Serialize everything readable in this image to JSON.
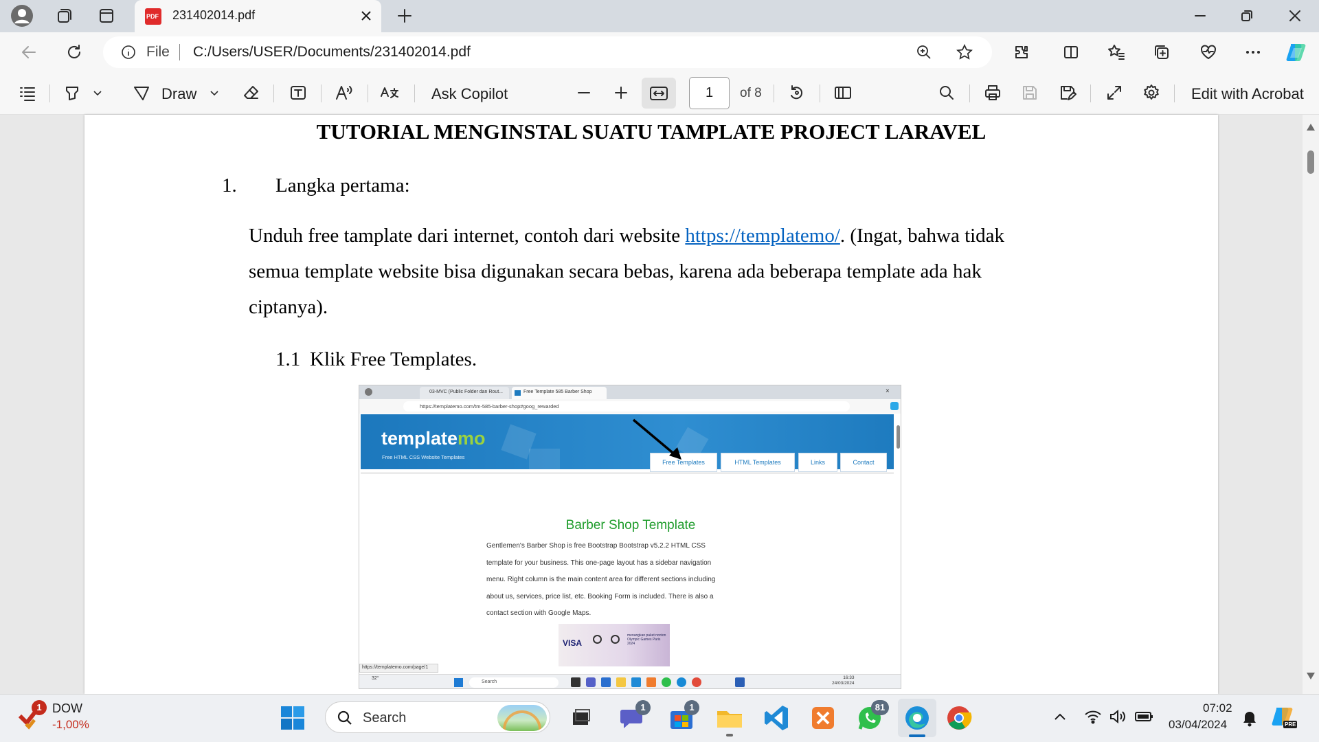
{
  "browser": {
    "tab_title": "231402014.pdf",
    "address_prefix": "File",
    "address": "C:/Users/USER/Documents/231402014.pdf"
  },
  "pdf_toolbar": {
    "draw_label": "Draw",
    "ask_copilot": "Ask Copilot",
    "page_current": "1",
    "page_total": "of 8",
    "edit_acrobat": "Edit with Acrobat"
  },
  "document": {
    "title": "TUTORIAL MENGINSTAL SUATU TAMPLATE PROJECT LARAVEL",
    "step_number": "1.",
    "step_label": "Langka pertama:",
    "para_line1_a": "Unduh free tamplate dari internet, contoh dari website ",
    "para_link": "https://templatemo/",
    "para_line1_b": ". (Ingat, bahwa tidak",
    "para_line2": "semua template website bisa digunakan secara bebas, karena ada beberapa template ada hak",
    "para_line3": "ciptanya).",
    "substep_number": "1.1",
    "substep_label": "Klik Free Templates."
  },
  "screenshot": {
    "tab1": "03-MVC (Public Folder dan Rout...",
    "tab2": "Free Template 585 Barber Shop",
    "url": "https://templatemo.com/tm-585-barber-shop#goog_rewarded",
    "logo_a": "template",
    "logo_b": "mo",
    "tagline": "Free HTML CSS Website Templates",
    "nav": [
      "Free Templates",
      "HTML Templates",
      "Links",
      "Contact"
    ],
    "heading": "Barber Shop Template",
    "body_lines": [
      "Gentlemen's Barber Shop is free Bootstrap Bootstrap v5.2.2 HTML CSS",
      "template for your business. This one-page layout has a sidebar navigation",
      "menu. Right column is the main content area for different sections including",
      "about us, services, price list, etc. Booking Form is included. There is also a",
      "contact section with Google Maps."
    ],
    "ad_brand": "VISA",
    "ad_text": "menangkan paket nonton Olympic Games Paris 2024",
    "status_url": "https://templatemo.com/page/1",
    "taskbar_search": "Search",
    "temp": "32°",
    "time": "16:33",
    "date": "24/03/2024"
  },
  "taskbar": {
    "stock_name": "DOW",
    "stock_change": "-1,00%",
    "stock_badge": "1",
    "search_placeholder": "Search",
    "badge_teams": "1",
    "badge_store": "1",
    "badge_whatsapp": "81",
    "time": "07:02",
    "date": "03/04/2024",
    "copilot_label": "PRE"
  },
  "colors": {
    "accent": "#0f6cbd",
    "link": "#0563c1",
    "templatemo_blue": "#1e7bbf",
    "templatemo_green": "#1e9c2b",
    "stock_red": "#c42b1c"
  }
}
